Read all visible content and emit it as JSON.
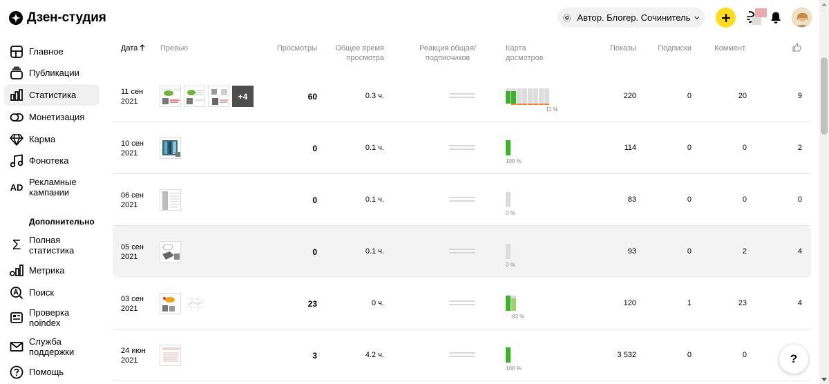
{
  "header": {
    "logo_text": "Дзен-студия",
    "channel_name": "Автор. Блогер. Сочинитель",
    "accent": "#ffdc1f"
  },
  "sidebar": {
    "items": [
      {
        "label": "Главное",
        "icon": "home-grid-icon"
      },
      {
        "label": "Публикации",
        "icon": "stack-icon"
      },
      {
        "label": "Статистика",
        "icon": "bar-chart-icon",
        "active": true
      },
      {
        "label": "Монетизация",
        "icon": "coins-icon"
      },
      {
        "label": "Карма",
        "icon": "diamond-icon"
      },
      {
        "label": "Фонотека",
        "icon": "music-note-icon"
      },
      {
        "label": "Рекламные кампании",
        "icon": "ad-icon"
      }
    ],
    "section_heading": "Дополнительно",
    "extra_items": [
      {
        "label": "Полная статистика",
        "icon": "sigma-icon"
      },
      {
        "label": "Метрика",
        "icon": "metrika-icon"
      },
      {
        "label": "Поиск",
        "icon": "search-a-icon"
      },
      {
        "label": "Проверка noindex",
        "icon": "noindex-icon"
      },
      {
        "label": "Служба поддержки",
        "icon": "mail-icon"
      },
      {
        "label": "Помощь",
        "icon": "help-circle-icon"
      }
    ]
  },
  "table": {
    "headers": {
      "date": "Дата",
      "preview": "Превью",
      "views": "Просмотры",
      "total_time": "Общее время просмотра",
      "reaction": "Реакция общая/ подписчиков",
      "map": "Карта досмотров",
      "shows": "Показы",
      "subs": "Подписки",
      "comments": "Коммент.",
      "likes_icon": "thumbs-up-icon"
    },
    "rows": [
      {
        "date": "11 сен 2021",
        "views": "60",
        "time": "0.3 ч.",
        "shows": "220",
        "subs": "0",
        "comments": "20",
        "likes": "9",
        "pct": "11 %",
        "more": "+4",
        "fills": [
          0.82,
          0.82,
          0,
          0,
          0,
          0,
          0,
          0
        ]
      },
      {
        "date": "10 сен 2021",
        "views": "0",
        "time": "0.1 ч.",
        "shows": "114",
        "subs": "0",
        "comments": "0",
        "likes": "2",
        "pct": "100 %",
        "fills": [
          1
        ]
      },
      {
        "date": "06 сен 2021",
        "views": "0",
        "time": "0.1 ч.",
        "shows": "83",
        "subs": "0",
        "comments": "0",
        "likes": "0",
        "pct": "0 %",
        "fills": [
          0
        ]
      },
      {
        "date": "05 сен 2021",
        "views": "0",
        "time": "0.1 ч.",
        "shows": "93",
        "subs": "0",
        "comments": "2",
        "likes": "4",
        "pct": "0 %",
        "fills": [
          0
        ]
      },
      {
        "date": "03 сен 2021",
        "views": "23",
        "time": "0 ч.",
        "shows": "120",
        "subs": "1",
        "comments": "23",
        "likes": "4",
        "pct": "83 %",
        "fills": [
          1,
          0.83
        ]
      },
      {
        "date": "24 июн 2021",
        "views": "3",
        "time": "4.2 ч.",
        "shows": "3 532",
        "subs": "0",
        "comments": "0",
        "likes": "",
        "pct": "100 %",
        "fills": [
          1
        ]
      }
    ]
  },
  "help_button": "?"
}
